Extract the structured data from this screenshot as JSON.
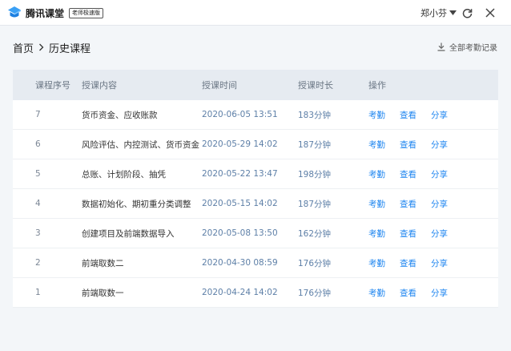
{
  "app": {
    "brand": "腾讯课堂",
    "edition_badge": "老师极速版"
  },
  "header": {
    "user_name": "郑小芬",
    "icons": {
      "user_menu": "chevron-down-icon",
      "refresh": "refresh-icon",
      "close": "close-icon"
    }
  },
  "breadcrumb": {
    "home": "首页",
    "current": "历史课程"
  },
  "toolbar": {
    "export_label": "全部考勤记录",
    "export_icon": "download-icon"
  },
  "table": {
    "headers": {
      "no": "课程序号",
      "content": "授课内容",
      "time": "授课时间",
      "duration": "授课时长",
      "ops": "操作"
    },
    "op_labels": {
      "attendance": "考勤",
      "view": "查看",
      "share": "分享"
    },
    "rows": [
      {
        "no": "7",
        "content": "货币资金、应收账款",
        "time": "2020-06-05 13:51",
        "duration": "183分钟"
      },
      {
        "no": "6",
        "content": "风险评估、内控测试、货币资金",
        "time": "2020-05-29 14:02",
        "duration": "187分钟"
      },
      {
        "no": "5",
        "content": "总账、计划阶段、抽凭",
        "time": "2020-05-22 13:47",
        "duration": "198分钟"
      },
      {
        "no": "4",
        "content": "数据初始化、期初重分类调整",
        "time": "2020-05-15 14:02",
        "duration": "187分钟"
      },
      {
        "no": "3",
        "content": "创建项目及前端数据导入",
        "time": "2020-05-08 13:50",
        "duration": "162分钟"
      },
      {
        "no": "2",
        "content": "前端取数二",
        "time": "2020-04-30 08:59",
        "duration": "176分钟"
      },
      {
        "no": "1",
        "content": "前端取数一",
        "time": "2020-04-24 14:02",
        "duration": "176分钟"
      }
    ]
  },
  "colors": {
    "accent": "#1f86f0",
    "header_bg": "#e6ebf1",
    "page_bg": "#f3f6f9"
  }
}
